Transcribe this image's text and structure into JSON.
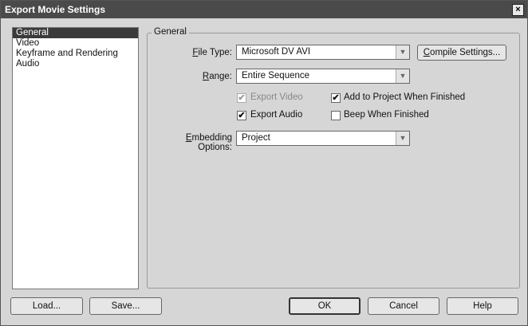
{
  "window": {
    "title": "Export Movie Settings",
    "close_glyph": "×"
  },
  "sidebar": {
    "items": [
      {
        "label": "General",
        "selected": true
      },
      {
        "label": "Video",
        "selected": false
      },
      {
        "label": "Keyframe and Rendering",
        "selected": false
      },
      {
        "label": "Audio",
        "selected": false
      }
    ]
  },
  "general": {
    "group_title": "General",
    "file_type": {
      "label_u": "F",
      "label_rest": "ile Type:",
      "value": "Microsoft DV AVI"
    },
    "compile_button": {
      "label_u": "C",
      "label_rest": "ompile Settings..."
    },
    "range": {
      "label_u": "R",
      "label_rest": "ange:",
      "value": "Entire Sequence"
    },
    "export_video": {
      "label": "Export Video",
      "checked": true,
      "disabled": true
    },
    "add_to_project": {
      "label": "Add to Project When Finished",
      "checked": true
    },
    "export_audio": {
      "label": "Export Audio",
      "checked": true
    },
    "beep": {
      "label": "Beep When Finished",
      "checked": false
    },
    "embedding": {
      "label_u": "E",
      "label_rest": "mbedding Options:",
      "value": "Project"
    },
    "check_glyph": "✔",
    "arrow_glyph": "▼"
  },
  "footer": {
    "load": "Load...",
    "save": "Save...",
    "ok": "OK",
    "cancel": "Cancel",
    "help": "Help"
  }
}
